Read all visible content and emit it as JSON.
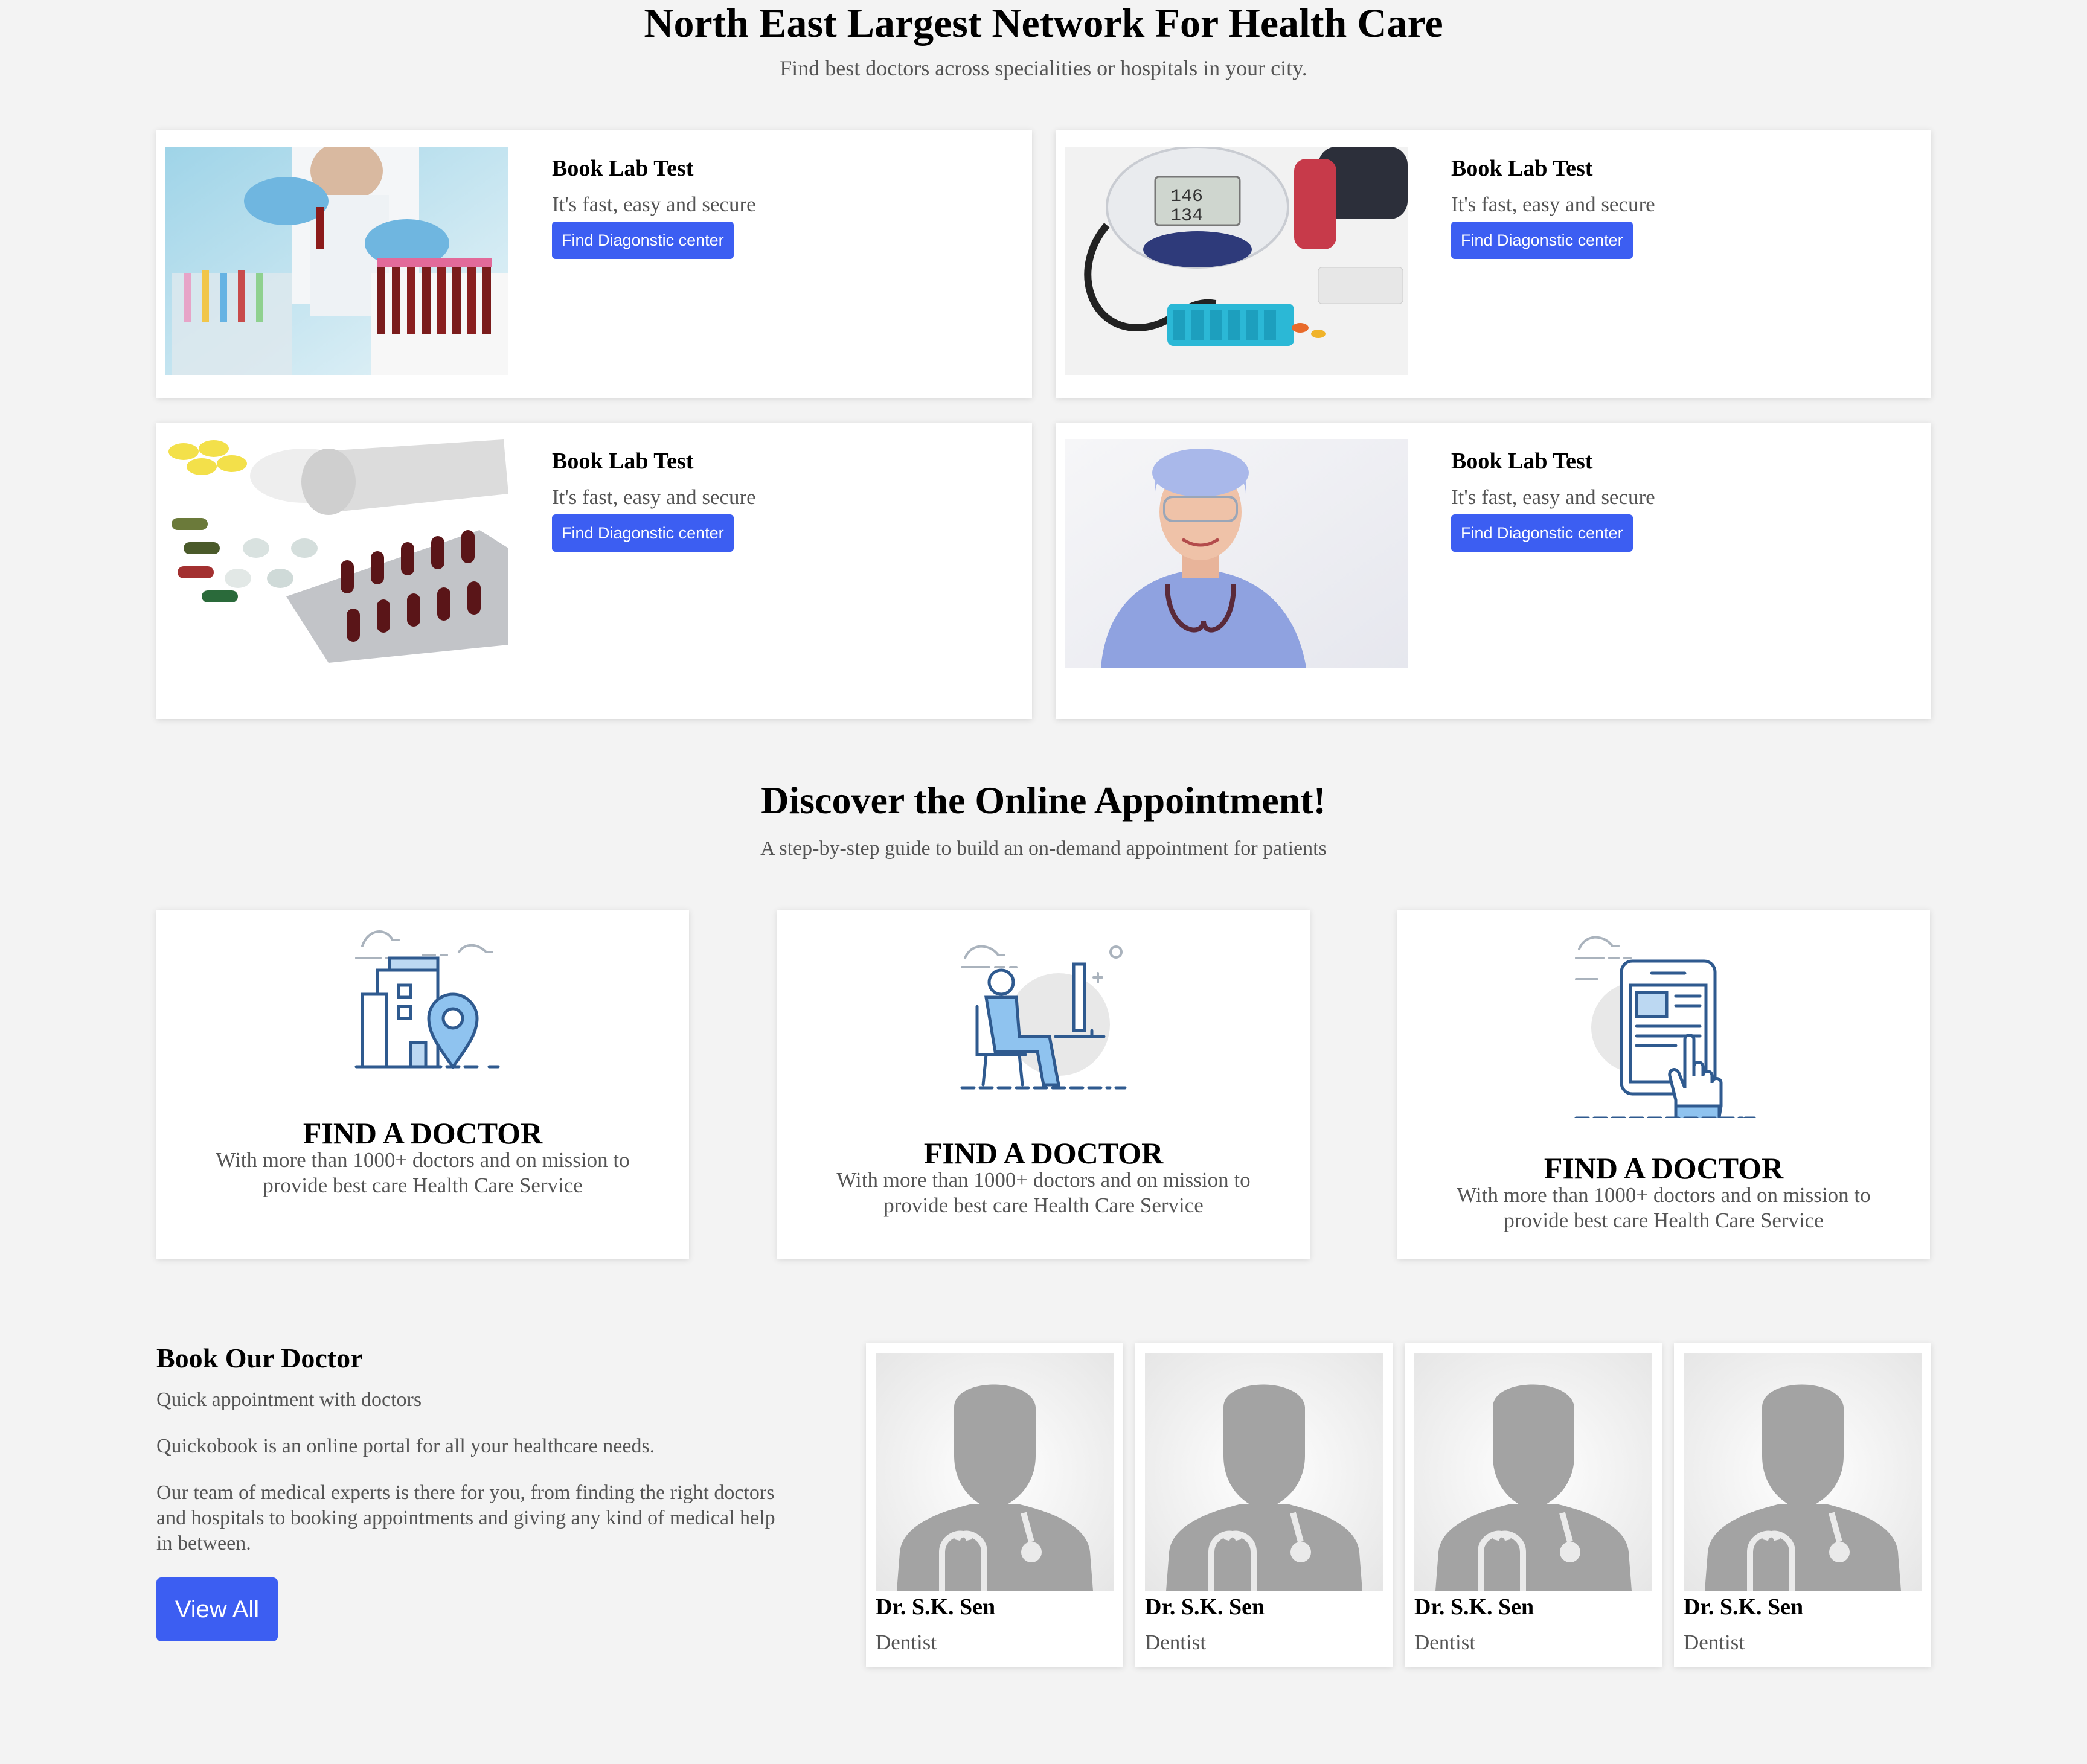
{
  "hero": {
    "title": "North East Largest Network For Health Care",
    "subtitle": "Find best doctors across specialities or hospitals in your city."
  },
  "lab_cards": [
    {
      "image": "lab-test-tubes-photo",
      "title": "Book Lab Test",
      "desc": "It's fast, easy and secure",
      "button": "Find Diagonstic center"
    },
    {
      "image": "blood-pressure-monitor-photo",
      "title": "Book Lab Test",
      "desc": "It's fast, easy and secure",
      "button": "Find Diagonstic center"
    },
    {
      "image": "pills-capsules-photo",
      "title": "Book Lab Test",
      "desc": "It's fast, easy and secure",
      "button": "Find Diagonstic center"
    },
    {
      "image": "nurse-portrait-photo",
      "title": "Book Lab Test",
      "desc": "It's fast, easy and secure",
      "button": "Find Diagonstic center"
    }
  ],
  "discover": {
    "title": "Discover the Online Appointment!",
    "subtitle": "A step-by-step guide to build an on-demand appointment for patients"
  },
  "steps": [
    {
      "icon": "hospital-location-icon",
      "title": "FIND A DOCTOR",
      "text": "With more than 1000+ doctors and on mission to provide best care Health Care Service"
    },
    {
      "icon": "doctor-at-desk-icon",
      "title": "FIND A DOCTOR",
      "text": "With more than 1000+ doctors and on mission to provide best care Health Care Service"
    },
    {
      "icon": "tablet-booking-icon",
      "title": "FIND A DOCTOR",
      "text": "With more than 1000+ doctors and on mission to provide best care Health Care Service"
    }
  ],
  "book": {
    "title": "Book Our Doctor",
    "p1": "Quick appointment with doctors",
    "p2": "Quickobook is an online portal for all your healthcare needs.",
    "p3": "Our team of medical experts is there for you, from finding the right doctors and hospitals to booking appointments and giving any kind of medical help in between.",
    "button": "View All"
  },
  "doctors": [
    {
      "name": "Dr. S.K. Sen",
      "specialty": "Dentist"
    },
    {
      "name": "Dr. S.K. Sen",
      "specialty": "Dentist"
    },
    {
      "name": "Dr. S.K. Sen",
      "specialty": "Dentist"
    },
    {
      "name": "Dr. S.K. Sen",
      "specialty": "Dentist"
    }
  ],
  "colors": {
    "accent": "#3c5ef2",
    "background": "#f3f3f3",
    "icon_line": "#2f5a8f",
    "icon_fill": "#8fc3ef"
  }
}
